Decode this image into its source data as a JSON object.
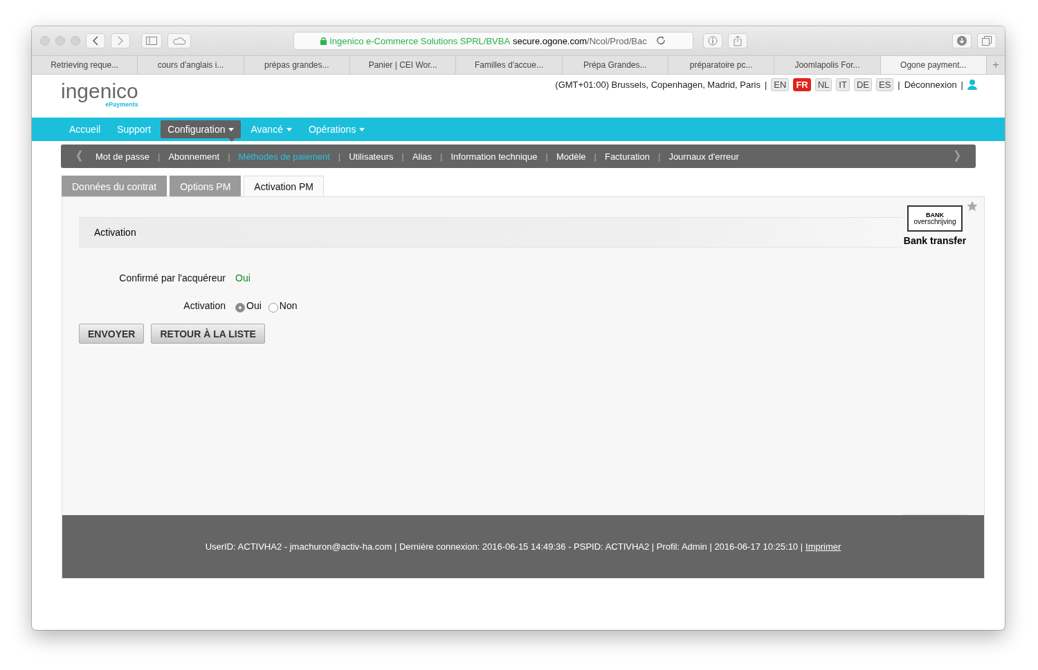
{
  "browser": {
    "address": {
      "org": "Ingenico e-Commerce Solutions SPRL/BVBA",
      "domain": "secure.ogone.com",
      "path": "/Ncol/Prod/Bac"
    },
    "tabs": [
      {
        "label": "Retrieving reque...",
        "selected": false
      },
      {
        "label": "cours d'anglais i...",
        "selected": false
      },
      {
        "label": "prépas grandes...",
        "selected": false
      },
      {
        "label": "Panier | CEI Wor...",
        "selected": false
      },
      {
        "label": "Familles d'accue...",
        "selected": false
      },
      {
        "label": "Prépa Grandes...",
        "selected": false
      },
      {
        "label": "préparatoire pc...",
        "selected": false
      },
      {
        "label": "Joomlapolis For...",
        "selected": false
      },
      {
        "label": "Ogone payment...",
        "selected": true
      }
    ],
    "new_tab": "+"
  },
  "header": {
    "logo": "ingenico",
    "logo_sub": "ePayments",
    "timezone": "(GMT+01:00) Brussels, Copenhagen, Madrid, Paris",
    "separator": "|",
    "languages": [
      {
        "label": "EN",
        "selected": false
      },
      {
        "label": "FR",
        "selected": true
      },
      {
        "label": "NL",
        "selected": false
      },
      {
        "label": "IT",
        "selected": false
      },
      {
        "label": "DE",
        "selected": false
      },
      {
        "label": "ES",
        "selected": false
      }
    ],
    "logout": "Déconnexion"
  },
  "main_menu": [
    {
      "label": "Accueil",
      "selected": false,
      "dropdown": false
    },
    {
      "label": "Support",
      "selected": false,
      "dropdown": false
    },
    {
      "label": "Configuration",
      "selected": true,
      "dropdown": true
    },
    {
      "label": "Avancé",
      "selected": false,
      "dropdown": true
    },
    {
      "label": "Opérations",
      "selected": false,
      "dropdown": true
    }
  ],
  "sub_menu": {
    "prev": "《",
    "next": "》",
    "separator": "|",
    "items": [
      {
        "label": "Mot de passe",
        "selected": false
      },
      {
        "label": "Abonnement",
        "selected": false
      },
      {
        "label": "Méthodes de paiement",
        "selected": true
      },
      {
        "label": "Utilisateurs",
        "selected": false
      },
      {
        "label": "Alias",
        "selected": false
      },
      {
        "label": "Information technique",
        "selected": false
      },
      {
        "label": "Modèle",
        "selected": false
      },
      {
        "label": "Facturation",
        "selected": false
      },
      {
        "label": "Journaux d'erreur",
        "selected": false
      }
    ]
  },
  "page_tabs": [
    {
      "label": "Données du contrat",
      "selected": false
    },
    {
      "label": "Options PM",
      "selected": false
    },
    {
      "label": "Activation PM",
      "selected": true
    }
  ],
  "payment_method": {
    "logo_line1": "BANK",
    "logo_line2": "overschrijving",
    "name": "Bank transfer"
  },
  "section": {
    "title": "Activation"
  },
  "fields": [
    {
      "kind": "value",
      "label": "Confirmé par l'acquéreur",
      "value": "Oui"
    },
    {
      "kind": "radio",
      "label": "Activation",
      "options": [
        {
          "label": "Oui",
          "selected": true
        },
        {
          "label": "Non",
          "selected": false
        }
      ]
    }
  ],
  "buttons": [
    "ENVOYER",
    "RETOUR À LA LISTE"
  ],
  "footer": {
    "text": "UserID: ACTIVHA2 - jmachuron@activ-ha.com | Dernière connexion: 2016-06-15 14:49:36 - PSPID: ACTIVHA2 | Profil: Admin | 2016-06-17 10:25:10 |",
    "link": "Imprimer"
  }
}
